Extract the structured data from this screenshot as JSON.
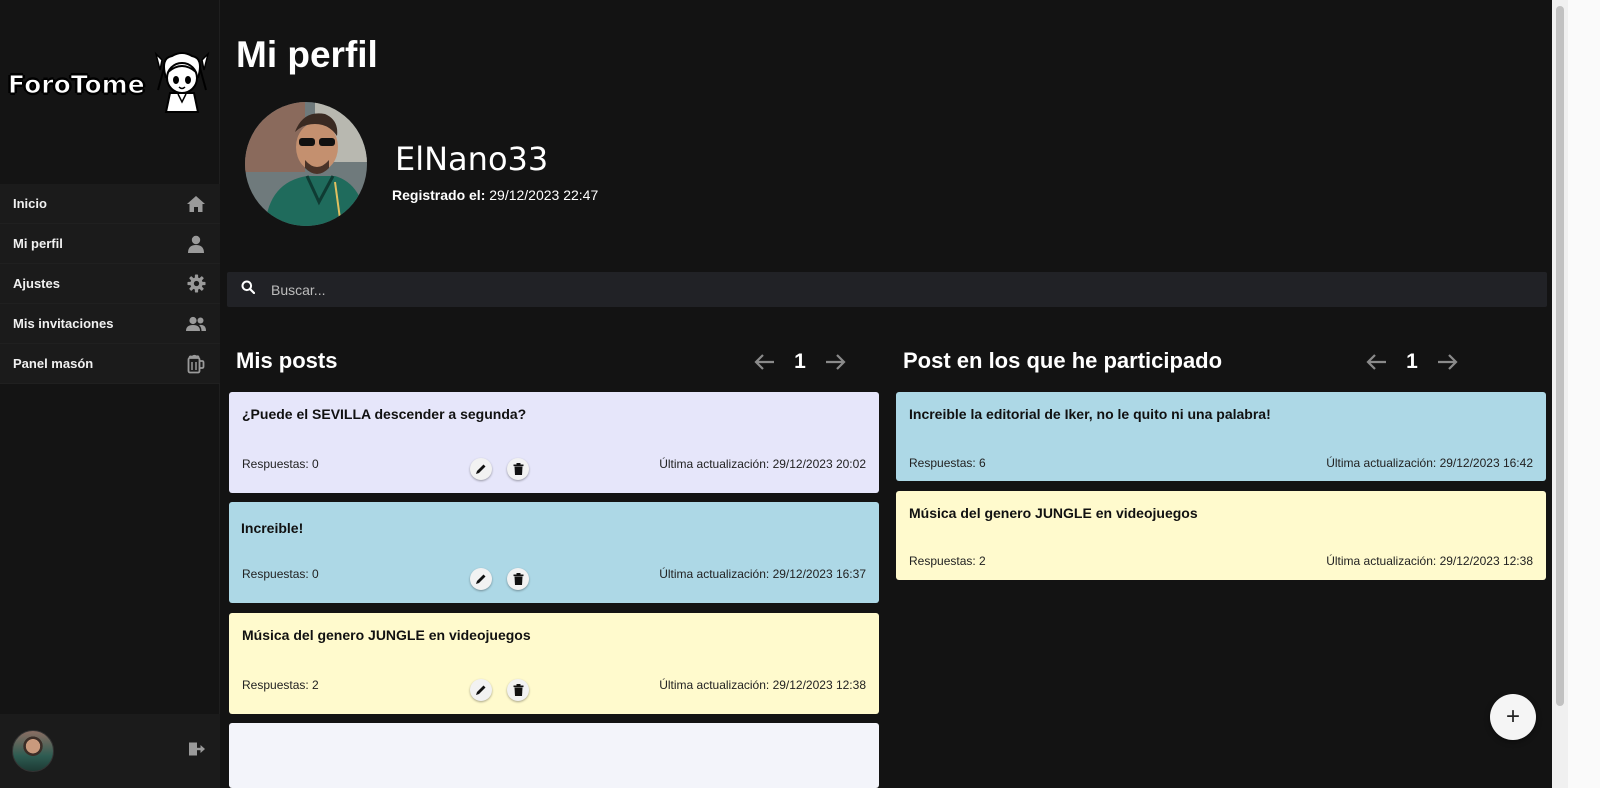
{
  "sidebar": {
    "logo_text": "ForoTome",
    "items": [
      {
        "label": "Inicio",
        "icon": "home-icon"
      },
      {
        "label": "Mi perfil",
        "icon": "user-icon"
      },
      {
        "label": "Ajustes",
        "icon": "gear-icon"
      },
      {
        "label": "Mis invitaciones",
        "icon": "users-icon"
      },
      {
        "label": "Panel masón",
        "icon": "beer-mug-icon"
      }
    ]
  },
  "profile": {
    "page_title": "Mi perfil",
    "username": "ElNano33",
    "registered_label": "Registrado el:",
    "registered_value": "29/12/2023 22:47"
  },
  "search": {
    "placeholder": "Buscar..."
  },
  "my_posts": {
    "title": "Mis posts",
    "page": "1",
    "posts": [
      {
        "title": "¿Puede el SEVILLA descender a segunda?",
        "replies": "Respuestas: 0",
        "updated": "Última actualización: 29/12/2023 20:02",
        "color": "#e6e6fa"
      },
      {
        "title": "Increible!",
        "replies": "Respuestas: 0",
        "updated": "Última actualización: 29/12/2023 16:37",
        "color": "#add8e6"
      },
      {
        "title": "Música del genero JUNGLE en videojuegos",
        "replies": "Respuestas: 2",
        "updated": "Última actualización: 29/12/2023 12:38",
        "color": "#fffacd"
      }
    ]
  },
  "participated": {
    "title": "Post en los que he participado",
    "page": "1",
    "posts": [
      {
        "title": "Increible la editorial de Iker, no le quito ni una palabra!",
        "replies": "Respuestas: 6",
        "updated": "Última actualización: 29/12/2023 16:42",
        "color": "#add8e6"
      },
      {
        "title": "Música del genero JUNGLE en videojuegos",
        "replies": "Respuestas: 2",
        "updated": "Última actualización: 29/12/2023 12:38",
        "color": "#fffacd"
      }
    ]
  },
  "fab": {
    "icon": "plus-icon",
    "symbol": "+"
  }
}
